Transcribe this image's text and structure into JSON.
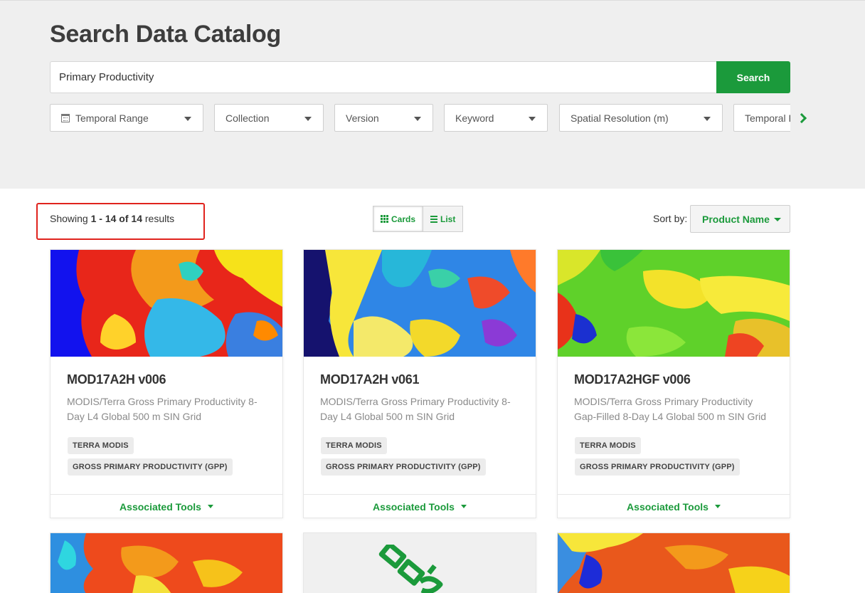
{
  "page": {
    "title": "Search Data Catalog"
  },
  "search": {
    "value": "Primary Productivity",
    "placeholder": "",
    "button_label": "Search"
  },
  "filters": {
    "items": [
      {
        "label": "Temporal Range",
        "icon": "calendar-icon"
      },
      {
        "label": "Collection"
      },
      {
        "label": "Version"
      },
      {
        "label": "Keyword"
      },
      {
        "label": "Spatial Resolution (m)"
      },
      {
        "label": "Temporal Resolution"
      }
    ],
    "next_icon": "chevron-right-icon"
  },
  "results": {
    "prefix": "Showing",
    "range": "1 - 14",
    "of_label": "of",
    "total": "14",
    "suffix": "results"
  },
  "view": {
    "cards_label": "Cards",
    "list_label": "List",
    "active": "cards"
  },
  "sort": {
    "label": "Sort by:",
    "value": "Product Name"
  },
  "cards": [
    {
      "title": "MOD17A2H v006",
      "description": "MODIS/Terra Gross Primary Productivity 8-Day L4 Global 500 m SIN Grid",
      "tags": [
        "TERRA MODIS",
        "GROSS PRIMARY PRODUCTIVITY (GPP)"
      ],
      "footer": "Associated Tools"
    },
    {
      "title": "MOD17A2H v061",
      "description": "MODIS/Terra Gross Primary Productivity 8-Day L4 Global 500 m SIN Grid",
      "tags": [
        "TERRA MODIS",
        "GROSS PRIMARY PRODUCTIVITY (GPP)"
      ],
      "footer": "Associated Tools"
    },
    {
      "title": "MOD17A2HGF v006",
      "description": "MODIS/Terra Gross Primary Productivity Gap-Filled 8-Day L4 Global 500 m SIN Grid",
      "tags": [
        "TERRA MODIS",
        "GROSS PRIMARY PRODUCTIVITY (GPP)"
      ],
      "footer": "Associated Tools"
    }
  ],
  "second_row": [
    {
      "image": "productivity-map"
    },
    {
      "image": "satellite-placeholder",
      "icon": "satellite-icon"
    },
    {
      "image": "productivity-map"
    }
  ],
  "colors": {
    "accent": "#1b9a3b",
    "highlight": "#e0231d",
    "hero_bg": "#efefef"
  }
}
